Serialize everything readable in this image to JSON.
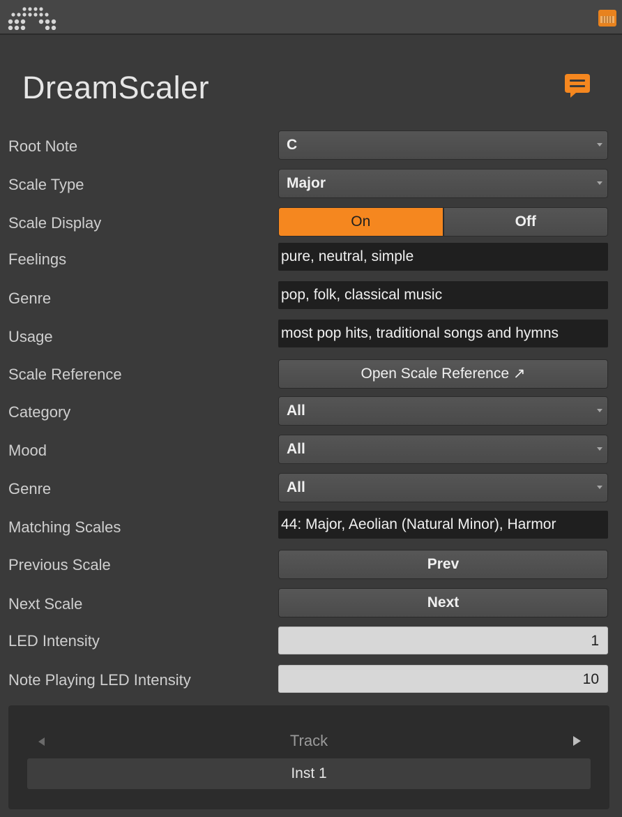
{
  "header": {
    "logo_icon": "grid-dots-logo-icon",
    "piano_icon": "piano-keyboard-icon",
    "accent_color": "#f5871f"
  },
  "device": {
    "title": "DreamScaler",
    "chat_icon": "speech-bubble-icon"
  },
  "params": {
    "root_note": {
      "label": "Root Note",
      "value": "C"
    },
    "scale_type": {
      "label": "Scale Type",
      "value": "Major"
    },
    "scale_display": {
      "label": "Scale Display",
      "on_label": "On",
      "off_label": "Off",
      "selected": "On"
    },
    "feelings": {
      "label": "Feelings",
      "value": "pure, neutral, simple"
    },
    "genre_info": {
      "label": "Genre",
      "value": "pop, folk, classical music"
    },
    "usage": {
      "label": "Usage",
      "value": "most pop hits, traditional songs and hymns"
    },
    "scale_reference": {
      "label": "Scale Reference",
      "button": "Open Scale Reference ↗"
    },
    "category": {
      "label": "Category",
      "value": "All"
    },
    "mood": {
      "label": "Mood",
      "value": "All"
    },
    "genre_filter": {
      "label": "Genre",
      "value": "All"
    },
    "matching_scales": {
      "label": "Matching Scales",
      "value": "44: Major, Aeolian (Natural Minor), Harmor"
    },
    "previous_scale": {
      "label": "Previous Scale",
      "button": "Prev"
    },
    "next_scale": {
      "label": "Next Scale",
      "button": "Next"
    },
    "led_intensity": {
      "label": "LED Intensity",
      "value": "1"
    },
    "note_led_intensity": {
      "label": "Note Playing LED Intensity",
      "value": "10"
    }
  },
  "track": {
    "label": "Track",
    "name": "Inst 1"
  }
}
